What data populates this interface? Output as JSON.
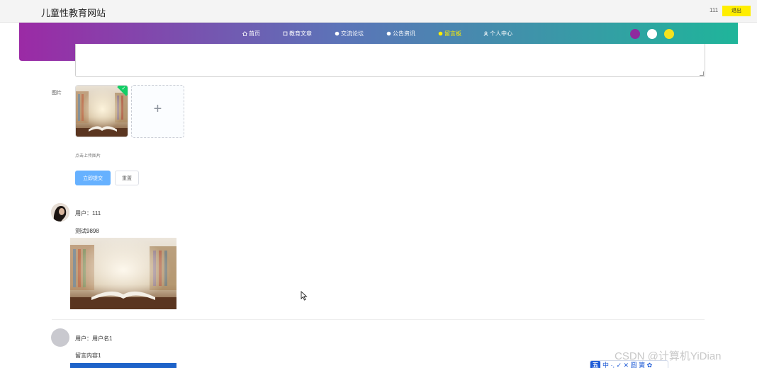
{
  "header": {
    "site_title": "儿童性教育网站",
    "username": "111",
    "logout_label": "退出"
  },
  "nav": {
    "items": [
      {
        "label": "首页",
        "icon": "home-icon"
      },
      {
        "label": "教育文章",
        "icon": "article-icon"
      },
      {
        "label": "交流论坛",
        "icon": "forum-icon"
      },
      {
        "label": "公告资讯",
        "icon": "notice-icon"
      },
      {
        "label": "留言板",
        "icon": "message-icon",
        "active": true
      },
      {
        "label": "个人中心",
        "icon": "user-icon"
      }
    ],
    "gradient_start": "#9b2aa5",
    "gradient_end": "#1fb59a",
    "active_color": "#ffee00",
    "theme_colors": [
      "#8e2a9e",
      "#ffffff",
      "#f5e21c"
    ]
  },
  "form": {
    "image_label": "图片",
    "upload_tip": "点击上传图片",
    "submit_label": "立即提交",
    "reset_label": "重置",
    "upload_plus": "+"
  },
  "comments": [
    {
      "user": "用户：111",
      "content": "测试9898"
    },
    {
      "user": "用户：用户名1",
      "content": "留言内容1"
    }
  ],
  "overlay": {
    "watermark": "CSDN @计算机YiDian",
    "ime_logo": "五",
    "ime_text": "中 ·, ✓ ✕ 圆 簧 ✿"
  }
}
